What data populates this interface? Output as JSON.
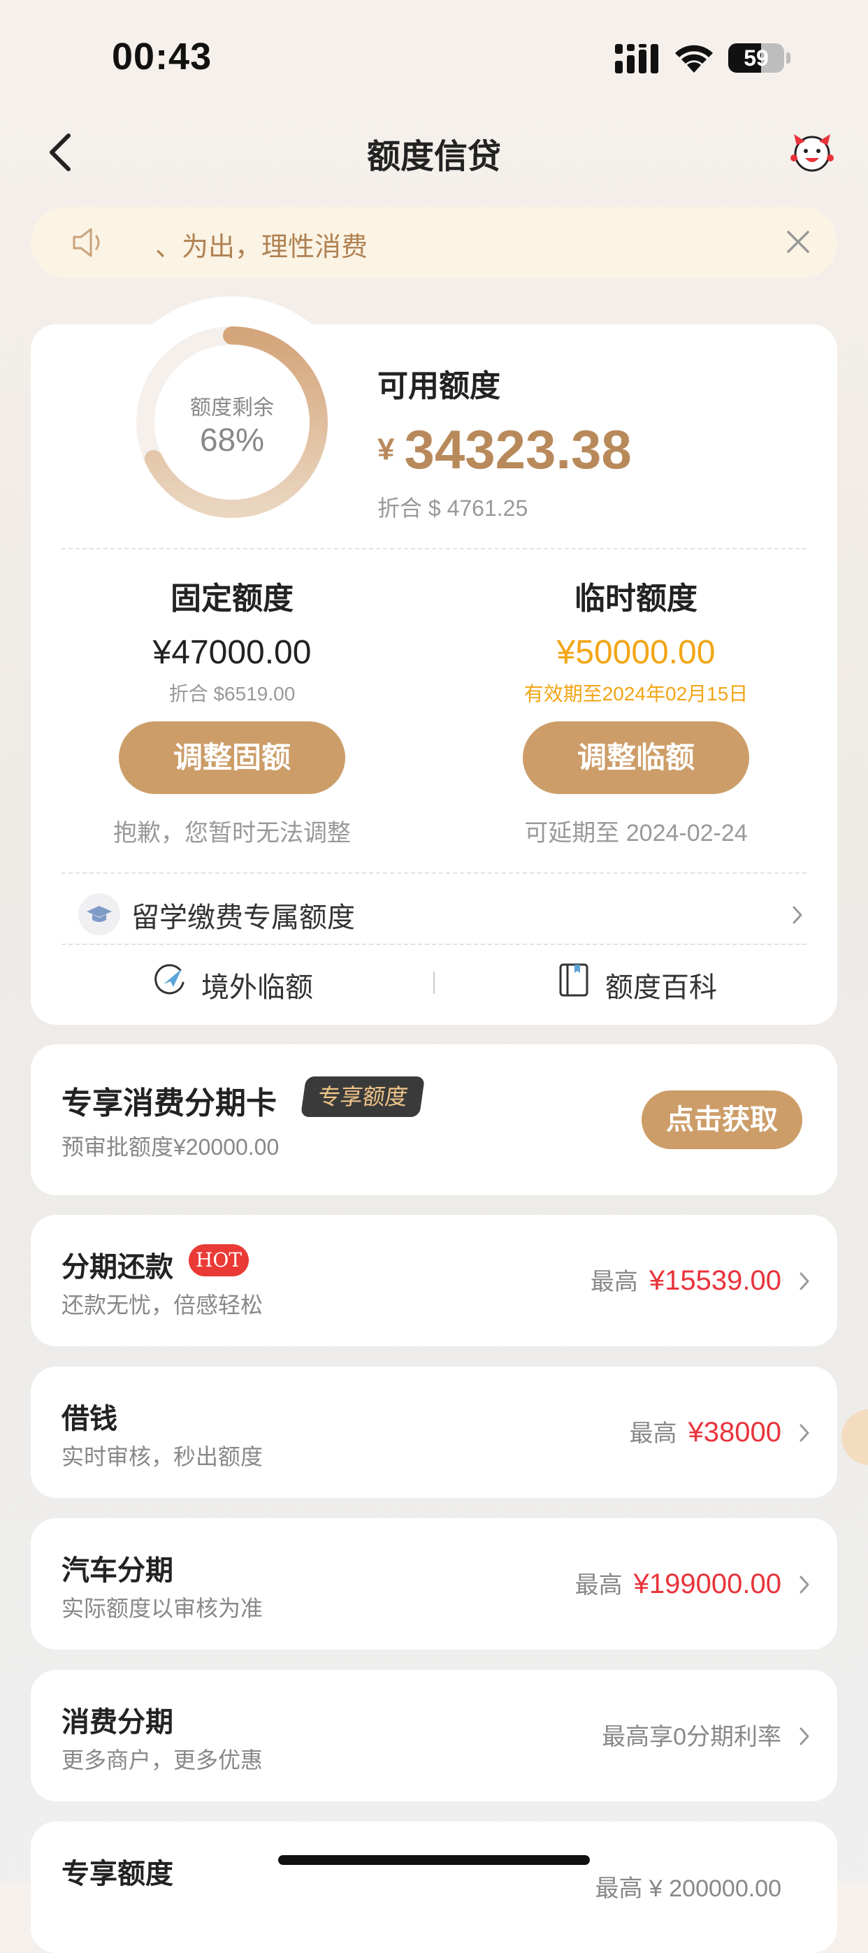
{
  "status_bar": {
    "time": "00:43",
    "battery": "59",
    "battery_level": 0.59
  },
  "nav": {
    "title": "额度信贷"
  },
  "notice": {
    "text": "、为出，理性消费"
  },
  "summary": {
    "donut_label": "额度剩余",
    "donut_percent": "68%",
    "donut_fraction": 0.68,
    "available_label": "可用额度",
    "currency_symbol": "¥",
    "available_amount": "34323.38",
    "available_usd": "折合 $ 4761.25"
  },
  "fixed": {
    "title": "固定额度",
    "amount": "¥47000.00",
    "usd": "折合 $6519.00",
    "button": "调整固额",
    "note": "抱歉，您暂时无法调整"
  },
  "temp": {
    "title": "临时额度",
    "amount": "¥50000.00",
    "validity": "有效期至2024年02月15日",
    "button": "调整临额",
    "note": "可延期至 2024-02-24"
  },
  "study": {
    "label": "留学缴费专属额度"
  },
  "links": {
    "overseas": "境外临额",
    "wiki": "额度百科"
  },
  "exclusive": {
    "title": "专享消费分期卡",
    "badge": "专享额度",
    "sub": "预审批额度¥20000.00",
    "button": "点击获取"
  },
  "list": [
    {
      "title": "分期还款",
      "badge": "HOT",
      "sub": "还款无忧，倍感轻松",
      "prefix": "最高",
      "value": "¥15539.00"
    },
    {
      "title": "借钱",
      "sub": "实时审核，秒出额度",
      "prefix": "最高",
      "value": "¥38000"
    },
    {
      "title": "汽车分期",
      "sub": "实际额度以审核为准",
      "prefix": "最高",
      "value": "¥199000.00"
    },
    {
      "title": "消费分期",
      "sub": "更多商户，更多优惠",
      "plain": "最高享0分期利率"
    },
    {
      "title": "专享额度",
      "plain": "最高 ¥ 200000.00"
    }
  ],
  "colors": {
    "accent": "#cc9d68",
    "gold_text": "#b8895a",
    "red": "#e8333b",
    "orange": "#f2a516"
  }
}
